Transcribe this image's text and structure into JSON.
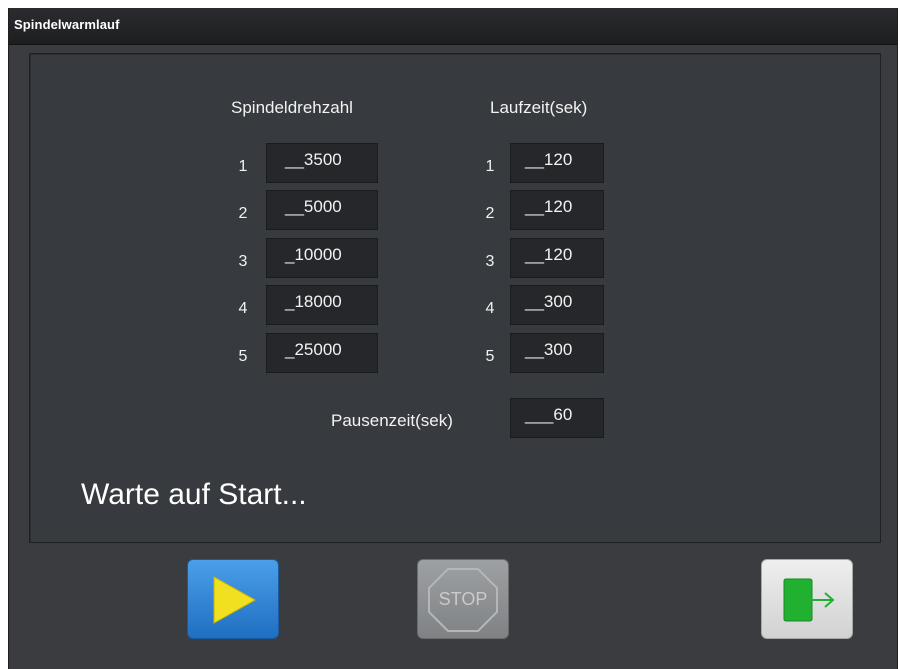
{
  "window": {
    "title": "Spindelwarmlauf"
  },
  "columns": {
    "spindle_header": "Spindeldrehzahl",
    "runtime_header": "Laufzeit(sek)"
  },
  "rows": [
    {
      "index": "1",
      "spindle": "__3500",
      "runtime": "__120"
    },
    {
      "index": "2",
      "spindle": "__5000",
      "runtime": "__120"
    },
    {
      "index": "3",
      "spindle": "_10000",
      "runtime": "__120"
    },
    {
      "index": "4",
      "spindle": "_18000",
      "runtime": "__300"
    },
    {
      "index": "5",
      "spindle": "_25000",
      "runtime": "__300"
    }
  ],
  "pause": {
    "label": "Pausenzeit(sek)",
    "value": "___60"
  },
  "status": {
    "text": "Warte auf Start..."
  },
  "buttons": {
    "start_icon": "play-icon",
    "stop_label": "STOP",
    "exit_icon": "exit-door-arrow-icon"
  },
  "colors": {
    "background": "#3a3c40",
    "field": "#25272a",
    "start_button": "#2f86d6",
    "stop_button": "#8e9193",
    "exit_button": "#e0e0e0",
    "play_triangle": "#f0e020",
    "exit_door": "#22b030"
  }
}
